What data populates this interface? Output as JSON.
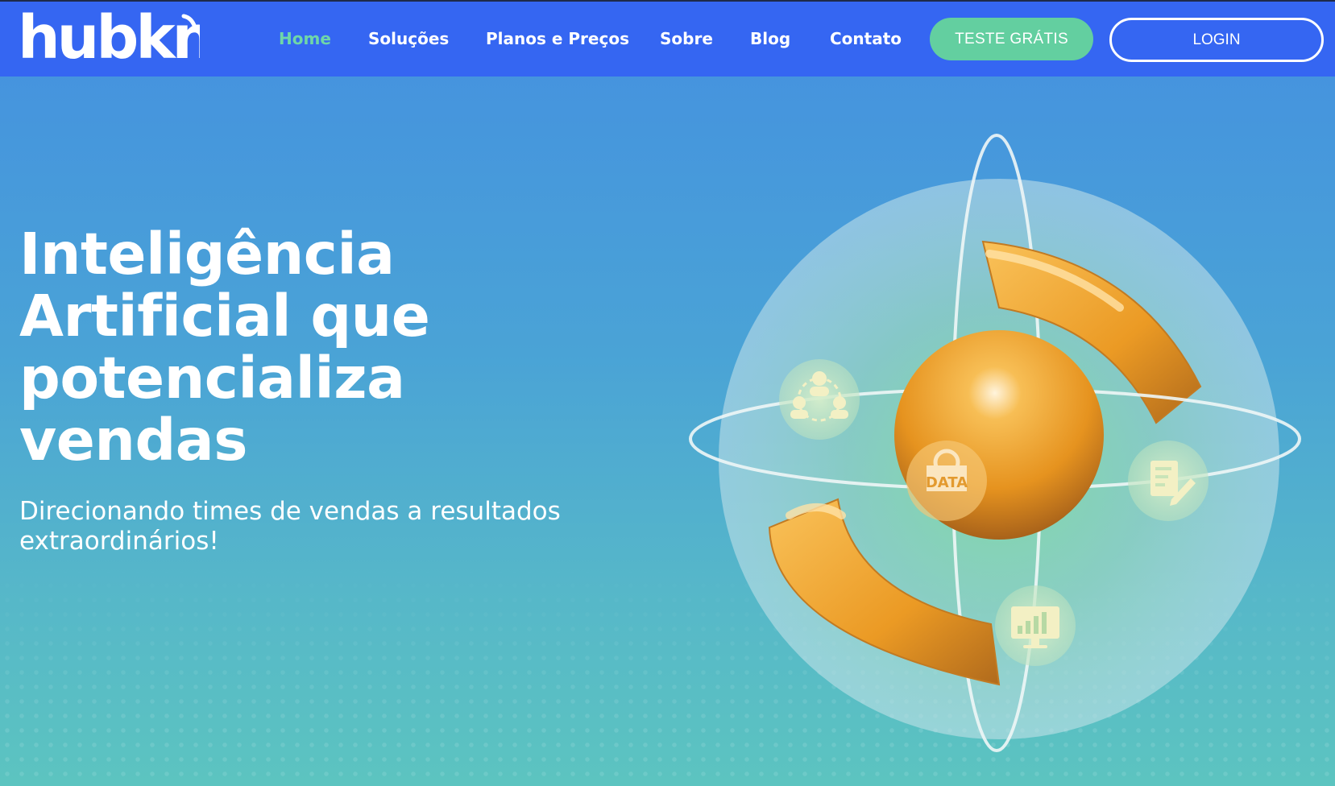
{
  "header": {
    "logo_text": "hubkn",
    "nav": [
      {
        "label": "Home",
        "active": true
      },
      {
        "label": "Soluções",
        "active": false
      },
      {
        "label": "Planos e Preços",
        "active": false
      },
      {
        "label": "Sobre",
        "active": false
      },
      {
        "label": "Blog",
        "active": false
      },
      {
        "label": "Contato",
        "active": false
      }
    ],
    "trial_button": "TESTE GRÁTIS",
    "login_button": "LOGIN"
  },
  "hero": {
    "title_lines": [
      "Inteligência",
      "Artificial que",
      "potencializa",
      "vendas"
    ],
    "subtitle_lines": [
      "Direcionando times de vendas a resultados",
      "extraordinários!"
    ]
  },
  "illustration": {
    "center_badge": "DATA",
    "icons": [
      "team-network-icon",
      "data-gear-icon",
      "edit-document-icon",
      "analytics-monitor-icon"
    ]
  },
  "colors": {
    "header_bg": "#3566f2",
    "accent_green": "#63cfa0",
    "orange": "#f0a12b"
  }
}
